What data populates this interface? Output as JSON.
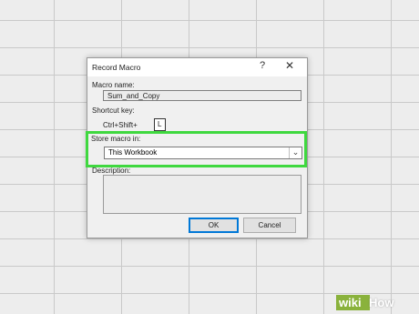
{
  "dialog": {
    "title": "Record Macro",
    "help_symbol": "?",
    "close_symbol": "✕",
    "macro_name_label": "Macro name:",
    "macro_name_value": "Sum_and_Copy",
    "shortcut_key_label": "Shortcut key:",
    "shortcut_prefix": "Ctrl+Shift+",
    "shortcut_value": "L",
    "store_label": "Store macro in:",
    "store_value": "This Workbook",
    "description_label": "Description:",
    "description_value": "",
    "ok_label": "OK",
    "cancel_label": "Cancel"
  },
  "highlight_color": "#3fd83f",
  "watermark": {
    "wiki": "wiki",
    "how": "How"
  }
}
